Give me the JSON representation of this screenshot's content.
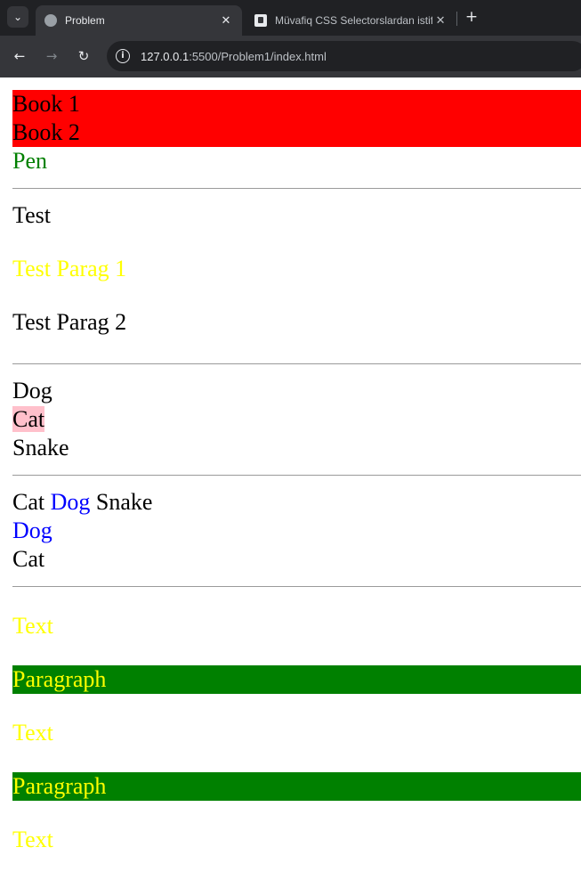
{
  "browser": {
    "tabs": [
      {
        "title": "Problem",
        "active": true
      },
      {
        "title": "Müvafiq CSS Selectorslardan istifadə",
        "active": false
      }
    ],
    "url_host": "127.0.0.1",
    "url_rest": ":5500/Problem1/index.html"
  },
  "content": {
    "book1": "Book 1",
    "book2": "Book 2",
    "pen": "Pen",
    "test": "Test",
    "parag1": "Test Parag 1",
    "parag2": "Test Parag 2",
    "dog": "Dog",
    "cat": "Cat",
    "snake": "Snake",
    "row_cat": "Cat",
    "row_dog": "Dog",
    "row_snake": "Snake",
    "dog2": "Dog",
    "cat2": "Cat",
    "text1": "Text",
    "paragraph1": "Paragraph",
    "text2": "Text",
    "paragraph2": "Paragraph",
    "text3": "Text"
  },
  "colors": {
    "chrome_bg": "#202124",
    "toolbar_bg": "#35363a",
    "red": "#ff0000",
    "green": "#008000",
    "yellow": "#ffff00",
    "blue": "#0000ff",
    "pink": "#ffc0cb"
  }
}
